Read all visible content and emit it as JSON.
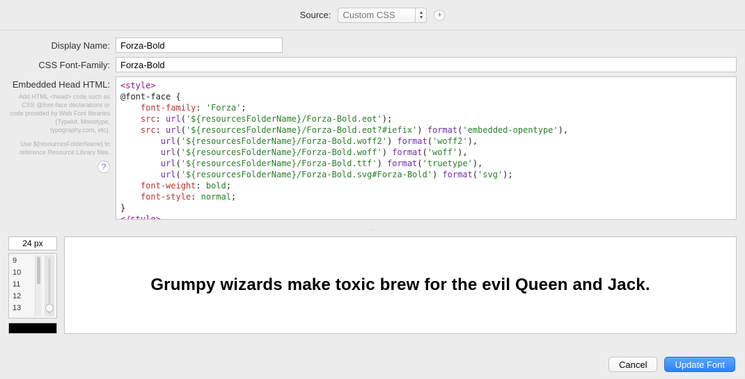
{
  "source": {
    "label": "Source:",
    "selected": "Custom CSS"
  },
  "fields": {
    "display_name_label": "Display Name:",
    "display_name_value": "Forza-Bold",
    "css_family_label": "CSS Font-Family:",
    "css_family_value": "Forza-Bold",
    "embedded_label": "Embedded Head HTML:",
    "help_text_1": "Add HTML <head> code such as CSS @font-face declarations or code provided by Web Font libraries (Typekit, Monotype, typography.com, etc).",
    "help_text_2": "Use ${resourcesFolderName} to reference Resource Library files."
  },
  "code": {
    "open_tag": "<style>",
    "rule_open": "@font-face {",
    "p1": "    font-family",
    "v1": "'Forza'",
    "p2": "    src",
    "v2a": "url",
    "v2b": "'${resourcesFolderName}/Forza-Bold.eot'",
    "p3": "    src",
    "v3a_url": "'${resourcesFolderName}/Forza-Bold.eot?#iefix'",
    "v3a_fmt": "'embedded-opentype'",
    "v3b_url": "'${resourcesFolderName}/Forza-Bold.woff2'",
    "v3b_fmt": "'woff2'",
    "v3c_url": "'${resourcesFolderName}/Forza-Bold.woff'",
    "v3c_fmt": "'woff'",
    "v3d_url": "'${resourcesFolderName}/Forza-Bold.ttf'",
    "v3d_fmt": "'truetype'",
    "v3e_url": "'${resourcesFolderName}/Forza-Bold.svg#Forza-Bold'",
    "v3e_fmt": "'svg'",
    "p4": "    font-weight",
    "v4": "bold",
    "p5": "    font-style",
    "v5": "normal",
    "rule_close": "}",
    "close_tag": "</style>",
    "kw_url": "url",
    "kw_format": "format"
  },
  "preview": {
    "size_text": "24 px",
    "sizes": [
      "9",
      "10",
      "11",
      "12",
      "13"
    ],
    "sample": "Grumpy wizards make toxic brew for the evil Queen and Jack.",
    "swatch_color": "#000000"
  },
  "buttons": {
    "cancel": "Cancel",
    "update": "Update Font"
  }
}
